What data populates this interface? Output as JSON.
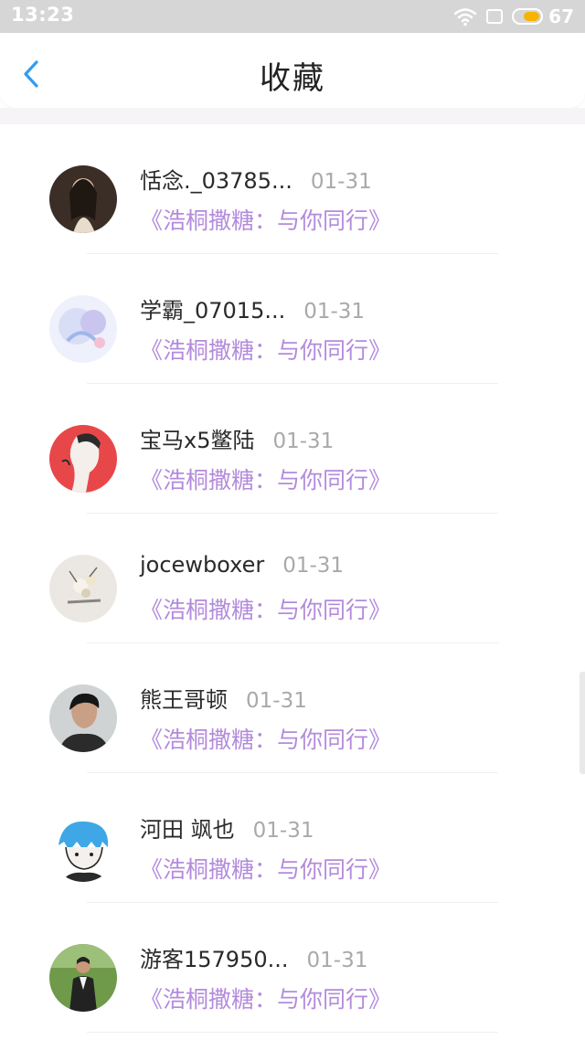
{
  "status_bar": {
    "time": "13:23",
    "battery_percent": "67",
    "battery_level": 0.67,
    "battery_color": "#f5b400",
    "icons": [
      "wifi-icon",
      "sim-icon",
      "battery-icon"
    ]
  },
  "header": {
    "title": "收藏",
    "back_icon": "chevron-left-icon",
    "accent_color": "#2f9df4"
  },
  "favorites": [
    {
      "username": "恬念._03785...",
      "date": "01-31",
      "title": "《浩桐撒糖：与你同行》",
      "avatar": "avatar-girl-dark-hair"
    },
    {
      "username": "学霸_07015...",
      "date": "01-31",
      "title": "《浩桐撒糖：与你同行》",
      "avatar": "avatar-pastel-anime"
    },
    {
      "username": "宝马x5鳖陆",
      "date": "01-31",
      "title": "《浩桐撒糖：与你同行》",
      "avatar": "avatar-red-sketch"
    },
    {
      "username": "jocewboxer",
      "date": "01-31",
      "title": "《浩桐撒糖：与你同行》",
      "avatar": "avatar-flowers"
    },
    {
      "username": "熊王哥顿",
      "date": "01-31",
      "title": "《浩桐撒糖：与你同行》",
      "avatar": "avatar-man-photo"
    },
    {
      "username": "河田 飒也",
      "date": "01-31",
      "title": "《浩桐撒糖：与你同行》",
      "avatar": "avatar-blue-anime"
    },
    {
      "username": "游客157950...",
      "date": "01-31",
      "title": "《浩桐撒糖：与你同行》",
      "avatar": "avatar-person-outdoor"
    }
  ],
  "colors": {
    "title_purple": "#b38bdc",
    "date_gray": "#a9a9a9",
    "status_bar_bg": "#d6d6d6"
  }
}
